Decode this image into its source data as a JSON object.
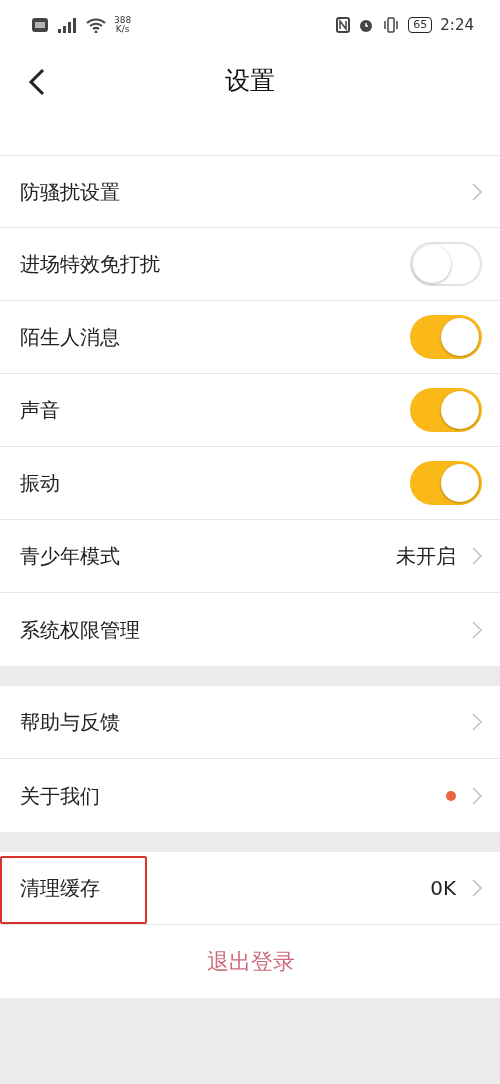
{
  "status_bar": {
    "network_speed": "388",
    "network_unit": "K/s",
    "battery": "65",
    "time": "2:24"
  },
  "header": {
    "title": "设置"
  },
  "sections": [
    {
      "items": [
        {
          "kind": "link",
          "label": "防骚扰设置"
        },
        {
          "kind": "toggle",
          "label": "进场特效免打扰",
          "on": false
        },
        {
          "kind": "toggle",
          "label": "陌生人消息",
          "on": true
        },
        {
          "kind": "toggle",
          "label": "声音",
          "on": true
        },
        {
          "kind": "toggle",
          "label": "振动",
          "on": true
        },
        {
          "kind": "value",
          "label": "青少年模式",
          "value": "未开启"
        },
        {
          "kind": "link",
          "label": "系统权限管理"
        }
      ]
    },
    {
      "items": [
        {
          "kind": "link",
          "label": "帮助与反馈"
        },
        {
          "kind": "dot",
          "label": "关于我们",
          "color": "#e8643c"
        }
      ]
    },
    {
      "items": [
        {
          "kind": "value",
          "label": "清理缓存",
          "value": "0K",
          "highlighted": true
        },
        {
          "kind": "action",
          "label": "退出登录"
        }
      ]
    }
  ]
}
